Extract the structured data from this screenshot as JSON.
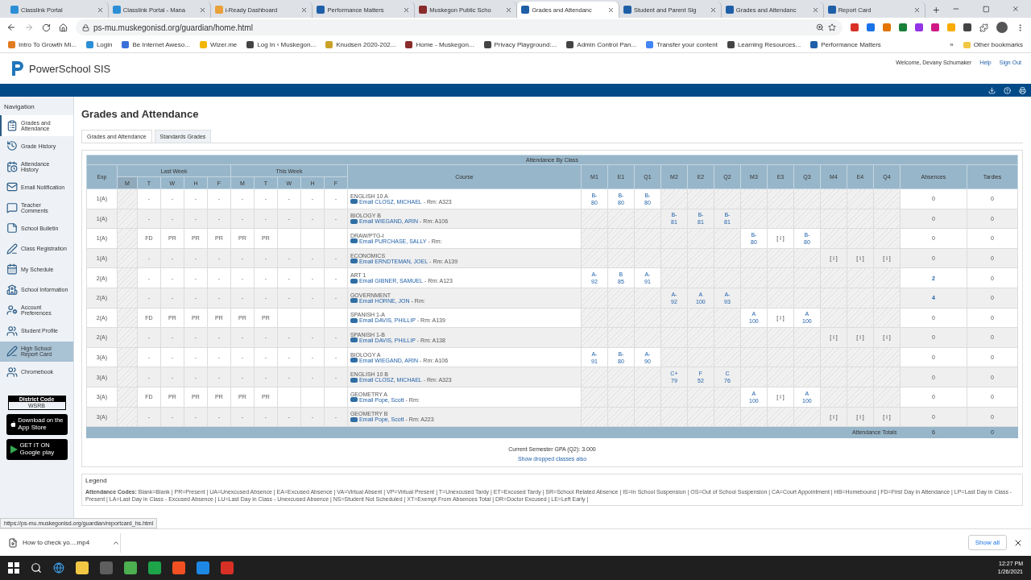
{
  "browser": {
    "tabs": [
      {
        "title": "Classlink Portal",
        "selected": false,
        "color": "#2c8fd6"
      },
      {
        "title": "Classlink Portal - Mana",
        "selected": false,
        "color": "#2c8fd6"
      },
      {
        "title": "i-Ready Dashboard",
        "selected": false,
        "color": "#e8a13a"
      },
      {
        "title": "Performance Matters",
        "selected": false,
        "color": "#1f5fa8"
      },
      {
        "title": "Muskegon Public Scho",
        "selected": false,
        "color": "#8a2b2b"
      },
      {
        "title": "Grades and Attendanc",
        "selected": true,
        "color": "#1f5fa8"
      },
      {
        "title": "Student and Parent Sig",
        "selected": false,
        "color": "#1f5fa8"
      },
      {
        "title": "Grades and Attendanc",
        "selected": false,
        "color": "#1f5fa8"
      },
      {
        "title": "Report Card",
        "selected": false,
        "color": "#1f5fa8"
      }
    ],
    "address": "ps-mu.muskegonisd.org/guardian/home.html",
    "bookmarks": [
      {
        "title": "Intro To Growth Mi...",
        "color": "#e07b1f"
      },
      {
        "title": "Login",
        "color": "#2c8fd6"
      },
      {
        "title": "Be Internet Aweso...",
        "color": "#3a6fd8"
      },
      {
        "title": "Wizer.me",
        "color": "#f2b705"
      },
      {
        "title": "Log In ‹ Muskegon...",
        "color": "#444444"
      },
      {
        "title": "Knudsen 2020-202...",
        "color": "#c9a227"
      },
      {
        "title": "Home - Muskegon...",
        "color": "#8a2b2b"
      },
      {
        "title": "Privacy Playground:...",
        "color": "#444444"
      },
      {
        "title": "Admin Control Pan...",
        "color": "#444444"
      },
      {
        "title": "Transfer your content",
        "color": "#4285f4"
      },
      {
        "title": "Learning Resources...",
        "color": "#444444"
      },
      {
        "title": "Performance Matters",
        "color": "#1f5fa8"
      }
    ],
    "more": "»",
    "other_bookmarks": "Other bookmarks"
  },
  "header": {
    "brand": "PowerSchool SIS",
    "welcome": "Welcome, Devany Schumaker",
    "links": [
      "Help",
      "Sign Out"
    ]
  },
  "sidebar": {
    "title": "Navigation",
    "items": [
      {
        "label": "Grades and Attendance",
        "selected": true,
        "hovered": false
      },
      {
        "label": "Grade History",
        "selected": false,
        "hovered": false
      },
      {
        "label": "Attendance History",
        "selected": false,
        "hovered": false
      },
      {
        "label": "Email Notification",
        "selected": false,
        "hovered": false
      },
      {
        "label": "Teacher Comments",
        "selected": false,
        "hovered": false
      },
      {
        "label": "School Bulletin",
        "selected": false,
        "hovered": false
      },
      {
        "label": "Class Registration",
        "selected": false,
        "hovered": false
      },
      {
        "label": "My Schedule",
        "selected": false,
        "hovered": false
      },
      {
        "label": "School Information",
        "selected": false,
        "hovered": false
      },
      {
        "label": "Account Preferences",
        "selected": false,
        "hovered": false
      },
      {
        "label": "Student Profile",
        "selected": false,
        "hovered": false
      },
      {
        "label": "High School Report Card",
        "selected": false,
        "hovered": true
      },
      {
        "label": "Chromebook",
        "selected": false,
        "hovered": false
      }
    ],
    "district": {
      "label": "District Code",
      "code": "WSRB"
    },
    "app_store": {
      "small": "Download on the",
      "big": "App Store"
    },
    "google_play": {
      "small": "GET IT ON",
      "big": "Google play"
    }
  },
  "content": {
    "title": "Grades and Attendance",
    "tabs": [
      {
        "label": "Grades and Attendance",
        "selected": true
      },
      {
        "label": "Standards Grades",
        "selected": false
      }
    ],
    "table": {
      "caption": "Attendance By Class",
      "exp": "Exp",
      "last_week": "Last Week",
      "this_week": "This Week",
      "days": [
        {
          "label": "M",
          "closed": true
        },
        {
          "label": "T",
          "closed": false
        },
        {
          "label": "W",
          "closed": false
        },
        {
          "label": "H",
          "closed": false
        },
        {
          "label": "F",
          "closed": false
        },
        {
          "label": "M",
          "closed": false
        },
        {
          "label": "T",
          "closed": false
        },
        {
          "label": "W",
          "closed": false
        },
        {
          "label": "H",
          "closed": false
        },
        {
          "label": "F",
          "closed": false
        }
      ],
      "course": "Course",
      "terms": [
        "M1",
        "E1",
        "Q1",
        "M2",
        "E2",
        "Q2",
        "M3",
        "E3",
        "Q3",
        "M4",
        "E4",
        "Q4"
      ],
      "absences": "Absences",
      "tardies": "Tardies",
      "rows": [
        {
          "exp": "1(A)",
          "days": [
            "-",
            "-",
            "-",
            "-",
            "-",
            "-",
            "-",
            "-",
            "-"
          ],
          "course": "ENGLISH 10 A",
          "email": "Email CLOSZ, MICHAEL",
          "room": " - Rm: A323",
          "grades": [
            {
              "kind": "grade",
              "letter": "B-",
              "score": "80"
            },
            {
              "kind": "grade",
              "letter": "B-",
              "score": "80"
            },
            {
              "kind": "grade",
              "letter": "B-",
              "score": "80"
            },
            {
              "kind": "empty"
            },
            {
              "kind": "empty"
            },
            {
              "kind": "empty"
            },
            {
              "kind": "empty"
            },
            {
              "kind": "empty"
            },
            {
              "kind": "empty"
            },
            {
              "kind": "empty"
            },
            {
              "kind": "empty"
            },
            {
              "kind": "empty"
            }
          ],
          "absences": "0",
          "absences_link": false,
          "tardies": "0"
        },
        {
          "exp": "1(A)",
          "days": [
            "-",
            "-",
            "-",
            "-",
            "-",
            "-",
            "-",
            "-",
            "-"
          ],
          "course": "BIOLOGY B",
          "email": "Email WIEGAND, ARIN",
          "room": " - Rm: A106",
          "grades": [
            {
              "kind": "empty"
            },
            {
              "kind": "empty"
            },
            {
              "kind": "empty"
            },
            {
              "kind": "grade",
              "letter": "B-",
              "score": "81"
            },
            {
              "kind": "grade",
              "letter": "B-",
              "score": "81"
            },
            {
              "kind": "grade",
              "letter": "B-",
              "score": "81"
            },
            {
              "kind": "empty"
            },
            {
              "kind": "empty"
            },
            {
              "kind": "empty"
            },
            {
              "kind": "empty"
            },
            {
              "kind": "empty"
            },
            {
              "kind": "empty"
            }
          ],
          "absences": "0",
          "absences_link": false,
          "tardies": "0"
        },
        {
          "exp": "1(A)",
          "days": [
            "FD",
            "PR",
            "PR",
            "PR",
            "PR",
            "PR"
          ],
          "course": "DRAW/PTG-I",
          "email": "Email PURCHASE, SALLY",
          "room": " - Rm:",
          "grades": [
            {
              "kind": "empty"
            },
            {
              "kind": "empty"
            },
            {
              "kind": "empty"
            },
            {
              "kind": "empty"
            },
            {
              "kind": "empty"
            },
            {
              "kind": "empty"
            },
            {
              "kind": "grade",
              "letter": "B-",
              "score": "80"
            },
            {
              "kind": "info",
              "text": "[ i ]"
            },
            {
              "kind": "grade",
              "letter": "B-",
              "score": "80"
            },
            {
              "kind": "empty"
            },
            {
              "kind": "empty"
            },
            {
              "kind": "empty"
            }
          ],
          "absences": "0",
          "absences_link": false,
          "tardies": "0"
        },
        {
          "exp": "1(A)",
          "days": [
            "-",
            "-",
            "-",
            "-",
            "-",
            "-",
            "-",
            "-",
            "-"
          ],
          "course": "ECONOMICS",
          "email": "Email ERNDTEMAN, JOEL",
          "room": " - Rm: A139",
          "grades": [
            {
              "kind": "empty"
            },
            {
              "kind": "empty"
            },
            {
              "kind": "empty"
            },
            {
              "kind": "empty"
            },
            {
              "kind": "empty"
            },
            {
              "kind": "empty"
            },
            {
              "kind": "empty"
            },
            {
              "kind": "empty"
            },
            {
              "kind": "empty"
            },
            {
              "kind": "info",
              "text": "[ i ]"
            },
            {
              "kind": "info",
              "text": "[ i ]"
            },
            {
              "kind": "info",
              "text": "[ i ]"
            }
          ],
          "absences": "0",
          "absences_link": false,
          "tardies": "0"
        },
        {
          "exp": "2(A)",
          "days": [
            "-",
            "-",
            "-",
            "-",
            "-",
            "-",
            "-",
            "-",
            "-"
          ],
          "course": "ART 1",
          "email": "Email GIBNER, SAMUEL",
          "room": " - Rm: A123",
          "grades": [
            {
              "kind": "grade",
              "letter": "A-",
              "score": "92"
            },
            {
              "kind": "grade",
              "letter": "B",
              "score": "85"
            },
            {
              "kind": "grade",
              "letter": "A-",
              "score": "91"
            },
            {
              "kind": "empty"
            },
            {
              "kind": "empty"
            },
            {
              "kind": "empty"
            },
            {
              "kind": "empty"
            },
            {
              "kind": "empty"
            },
            {
              "kind": "empty"
            },
            {
              "kind": "empty"
            },
            {
              "kind": "empty"
            },
            {
              "kind": "empty"
            }
          ],
          "absences": "2",
          "absences_link": true,
          "tardies": "0"
        },
        {
          "exp": "2(A)",
          "days": [
            "-",
            "-",
            "-",
            "-",
            "-",
            "-",
            "-",
            "-",
            "-"
          ],
          "course": "GOVERNMENT",
          "email": "Email HORNE, JON",
          "room": " - Rm:",
          "grades": [
            {
              "kind": "empty"
            },
            {
              "kind": "empty"
            },
            {
              "kind": "empty"
            },
            {
              "kind": "grade",
              "letter": "A-",
              "score": "92"
            },
            {
              "kind": "grade",
              "letter": "A",
              "score": "100"
            },
            {
              "kind": "grade",
              "letter": "A-",
              "score": "93"
            },
            {
              "kind": "empty"
            },
            {
              "kind": "empty"
            },
            {
              "kind": "empty"
            },
            {
              "kind": "empty"
            },
            {
              "kind": "empty"
            },
            {
              "kind": "empty"
            }
          ],
          "absences": "4",
          "absences_link": true,
          "tardies": "0"
        },
        {
          "exp": "2(A)",
          "days": [
            "FD",
            "PR",
            "PR",
            "PR",
            "PR",
            "PR"
          ],
          "course": "SPANISH 1-A",
          "email": "Email DAVIS, PHILLIP",
          "room": " - Rm: A139",
          "grades": [
            {
              "kind": "empty"
            },
            {
              "kind": "empty"
            },
            {
              "kind": "empty"
            },
            {
              "kind": "empty"
            },
            {
              "kind": "empty"
            },
            {
              "kind": "empty"
            },
            {
              "kind": "grade",
              "letter": "A",
              "score": "100"
            },
            {
              "kind": "info",
              "text": "[ i ]"
            },
            {
              "kind": "grade",
              "letter": "A",
              "score": "100"
            },
            {
              "kind": "empty"
            },
            {
              "kind": "empty"
            },
            {
              "kind": "empty"
            }
          ],
          "absences": "0",
          "absences_link": false,
          "tardies": "0"
        },
        {
          "exp": "2(A)",
          "days": [
            "-",
            "-",
            "-",
            "-",
            "-",
            "-",
            "-",
            "-",
            "-"
          ],
          "course": "SPANISH 1-B",
          "email": "Email DAVIS, PHILLIP",
          "room": " - Rm: A138",
          "grades": [
            {
              "kind": "empty"
            },
            {
              "kind": "empty"
            },
            {
              "kind": "empty"
            },
            {
              "kind": "empty"
            },
            {
              "kind": "empty"
            },
            {
              "kind": "empty"
            },
            {
              "kind": "empty"
            },
            {
              "kind": "empty"
            },
            {
              "kind": "empty"
            },
            {
              "kind": "info",
              "text": "[ i ]"
            },
            {
              "kind": "info",
              "text": "[ i ]"
            },
            {
              "kind": "info",
              "text": "[ i ]"
            }
          ],
          "absences": "0",
          "absences_link": false,
          "tardies": "0"
        },
        {
          "exp": "3(A)",
          "days": [
            "-",
            "-",
            "-",
            "-",
            "-",
            "-",
            "-",
            "-",
            "-"
          ],
          "course": "BIOLOGY A",
          "email": "Email WIEGAND, ARIN",
          "room": " - Rm: A106",
          "grades": [
            {
              "kind": "grade",
              "letter": "A-",
              "score": "91"
            },
            {
              "kind": "grade",
              "letter": "B-",
              "score": "80"
            },
            {
              "kind": "grade",
              "letter": "A-",
              "score": "90"
            },
            {
              "kind": "empty"
            },
            {
              "kind": "empty"
            },
            {
              "kind": "empty"
            },
            {
              "kind": "empty"
            },
            {
              "kind": "empty"
            },
            {
              "kind": "empty"
            },
            {
              "kind": "empty"
            },
            {
              "kind": "empty"
            },
            {
              "kind": "empty"
            }
          ],
          "absences": "0",
          "absences_link": false,
          "tardies": "0"
        },
        {
          "exp": "3(A)",
          "days": [
            "-",
            "-",
            "-",
            "-",
            "-",
            "-",
            "-",
            "-",
            "-"
          ],
          "course": "ENGLISH 10 B",
          "email": "Email CLOSZ, MICHAEL",
          "room": " - Rm: A323",
          "grades": [
            {
              "kind": "empty"
            },
            {
              "kind": "empty"
            },
            {
              "kind": "empty"
            },
            {
              "kind": "grade",
              "letter": "C+",
              "score": "79"
            },
            {
              "kind": "grade",
              "letter": "F",
              "score": "52"
            },
            {
              "kind": "grade",
              "letter": "C",
              "score": "76"
            },
            {
              "kind": "empty"
            },
            {
              "kind": "empty"
            },
            {
              "kind": "empty"
            },
            {
              "kind": "empty"
            },
            {
              "kind": "empty"
            },
            {
              "kind": "empty"
            }
          ],
          "absences": "0",
          "absences_link": false,
          "tardies": "0"
        },
        {
          "exp": "3(A)",
          "days": [
            "FD",
            "PR",
            "PR",
            "PR",
            "PR",
            "PR"
          ],
          "course": "GEOMETRY A",
          "email": "Email Pope, Scott",
          "room": " - Rm:",
          "grades": [
            {
              "kind": "empty"
            },
            {
              "kind": "empty"
            },
            {
              "kind": "empty"
            },
            {
              "kind": "empty"
            },
            {
              "kind": "empty"
            },
            {
              "kind": "empty"
            },
            {
              "kind": "grade",
              "letter": "A",
              "score": "100"
            },
            {
              "kind": "info",
              "text": "[ i ]"
            },
            {
              "kind": "grade",
              "letter": "A",
              "score": "100"
            },
            {
              "kind": "empty"
            },
            {
              "kind": "empty"
            },
            {
              "kind": "empty"
            }
          ],
          "absences": "0",
          "absences_link": false,
          "tardies": "0"
        },
        {
          "exp": "3(A)",
          "days": [
            "-",
            "-",
            "-",
            "-",
            "-",
            "-",
            "-",
            "-",
            "-"
          ],
          "course": "GEOMETRY B",
          "email": "Email Pope, Scott",
          "room": " - Rm: A223",
          "grades": [
            {
              "kind": "empty"
            },
            {
              "kind": "empty"
            },
            {
              "kind": "empty"
            },
            {
              "kind": "empty"
            },
            {
              "kind": "empty"
            },
            {
              "kind": "empty"
            },
            {
              "kind": "empty"
            },
            {
              "kind": "empty"
            },
            {
              "kind": "empty"
            },
            {
              "kind": "info",
              "text": "[ i ]"
            },
            {
              "kind": "info",
              "text": "[ i ]"
            },
            {
              "kind": "info",
              "text": "[ i ]"
            }
          ],
          "absences": "0",
          "absences_link": false,
          "tardies": "0"
        }
      ],
      "totals": {
        "label": "Attendance Totals",
        "absences": "6",
        "tardies": "0"
      }
    },
    "gpa": "Current Semester GPA (Q2): 3.000",
    "dropped_link": "Show dropped classes also",
    "legend": {
      "title": "Legend",
      "codes": "**Attendance Codes:** Blank=Blank | PR=Present | UA=Unexcused Absence | EA=Excused Absence | VA=Virtual Absent | VP=Virtual Present | T=Unexcused Tardy | ET=Excused Tardy | SR=School Related Absence | IS=In School Suspension | OS=Out of School Suspension | CA=Court Appointment | HB=Homebound | FD=First Day in Attendance | LP=Last Day in Class - Present | LA=Last Day in Class - Excused Absence | LU=Last Day in Class - Unexcused Absence | NS=Student Not Scheduled | XT=Exempt From Absences Total | DR=Doctor Excused | LE=Left Early |"
    }
  },
  "status_url": "https://ps-mu.muskegonisd.org/guardian/reportcard_hs.html",
  "download": {
    "file": "How to check yo....mp4",
    "show_all": "Show all"
  },
  "taskbar": {
    "time": "12:27 PM",
    "date": "1/26/2021"
  }
}
